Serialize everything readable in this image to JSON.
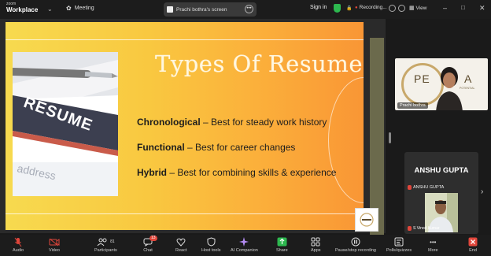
{
  "titlebar": {
    "brand_line1": "zoom",
    "brand_line2": "Workplace",
    "meeting_label": "Meeting",
    "share_tab_label": "Prachi bothra's screen",
    "signin_label": "Sign in",
    "recording_label": "Recording...",
    "view_label": "View"
  },
  "slide": {
    "title": "Types Of Resume",
    "photo_text": "RESUME",
    "bullets": [
      {
        "term": "Chronological",
        "desc": " – Best for steady work history"
      },
      {
        "term": "Functional",
        "desc": " – Best for career changes"
      },
      {
        "term": "Hybrid",
        "desc": " – Best for combining skills & experience"
      }
    ]
  },
  "participants": {
    "tile1_name": "Prachi bothra",
    "tile1_bg_text": "PE",
    "tile1_bg_text2": "A",
    "tile1_bg_sub": "POTENTIAL",
    "tile2_bigname": "ANSHU GUPTA",
    "tile2_name": "ANSHU GUPTA",
    "tile2_video_name": "S Vinod Kumar"
  },
  "toolbar": {
    "items": [
      {
        "label": "Audio"
      },
      {
        "label": "Video"
      },
      {
        "label": "Participants",
        "count": "81"
      },
      {
        "label": "Chat",
        "badge": "13"
      },
      {
        "label": "React"
      },
      {
        "label": "Host tools"
      },
      {
        "label": "AI Companion"
      },
      {
        "label": "Share"
      },
      {
        "label": "Apps"
      },
      {
        "label": "Pause/stop recording"
      },
      {
        "label": "Polls/quizzes"
      },
      {
        "label": "More"
      },
      {
        "label": "End"
      }
    ]
  },
  "colors": {
    "share_green": "#2db84f",
    "end_red": "#e0463b",
    "slide_yellow": "#f7da4f",
    "slide_orange": "#f99635"
  }
}
